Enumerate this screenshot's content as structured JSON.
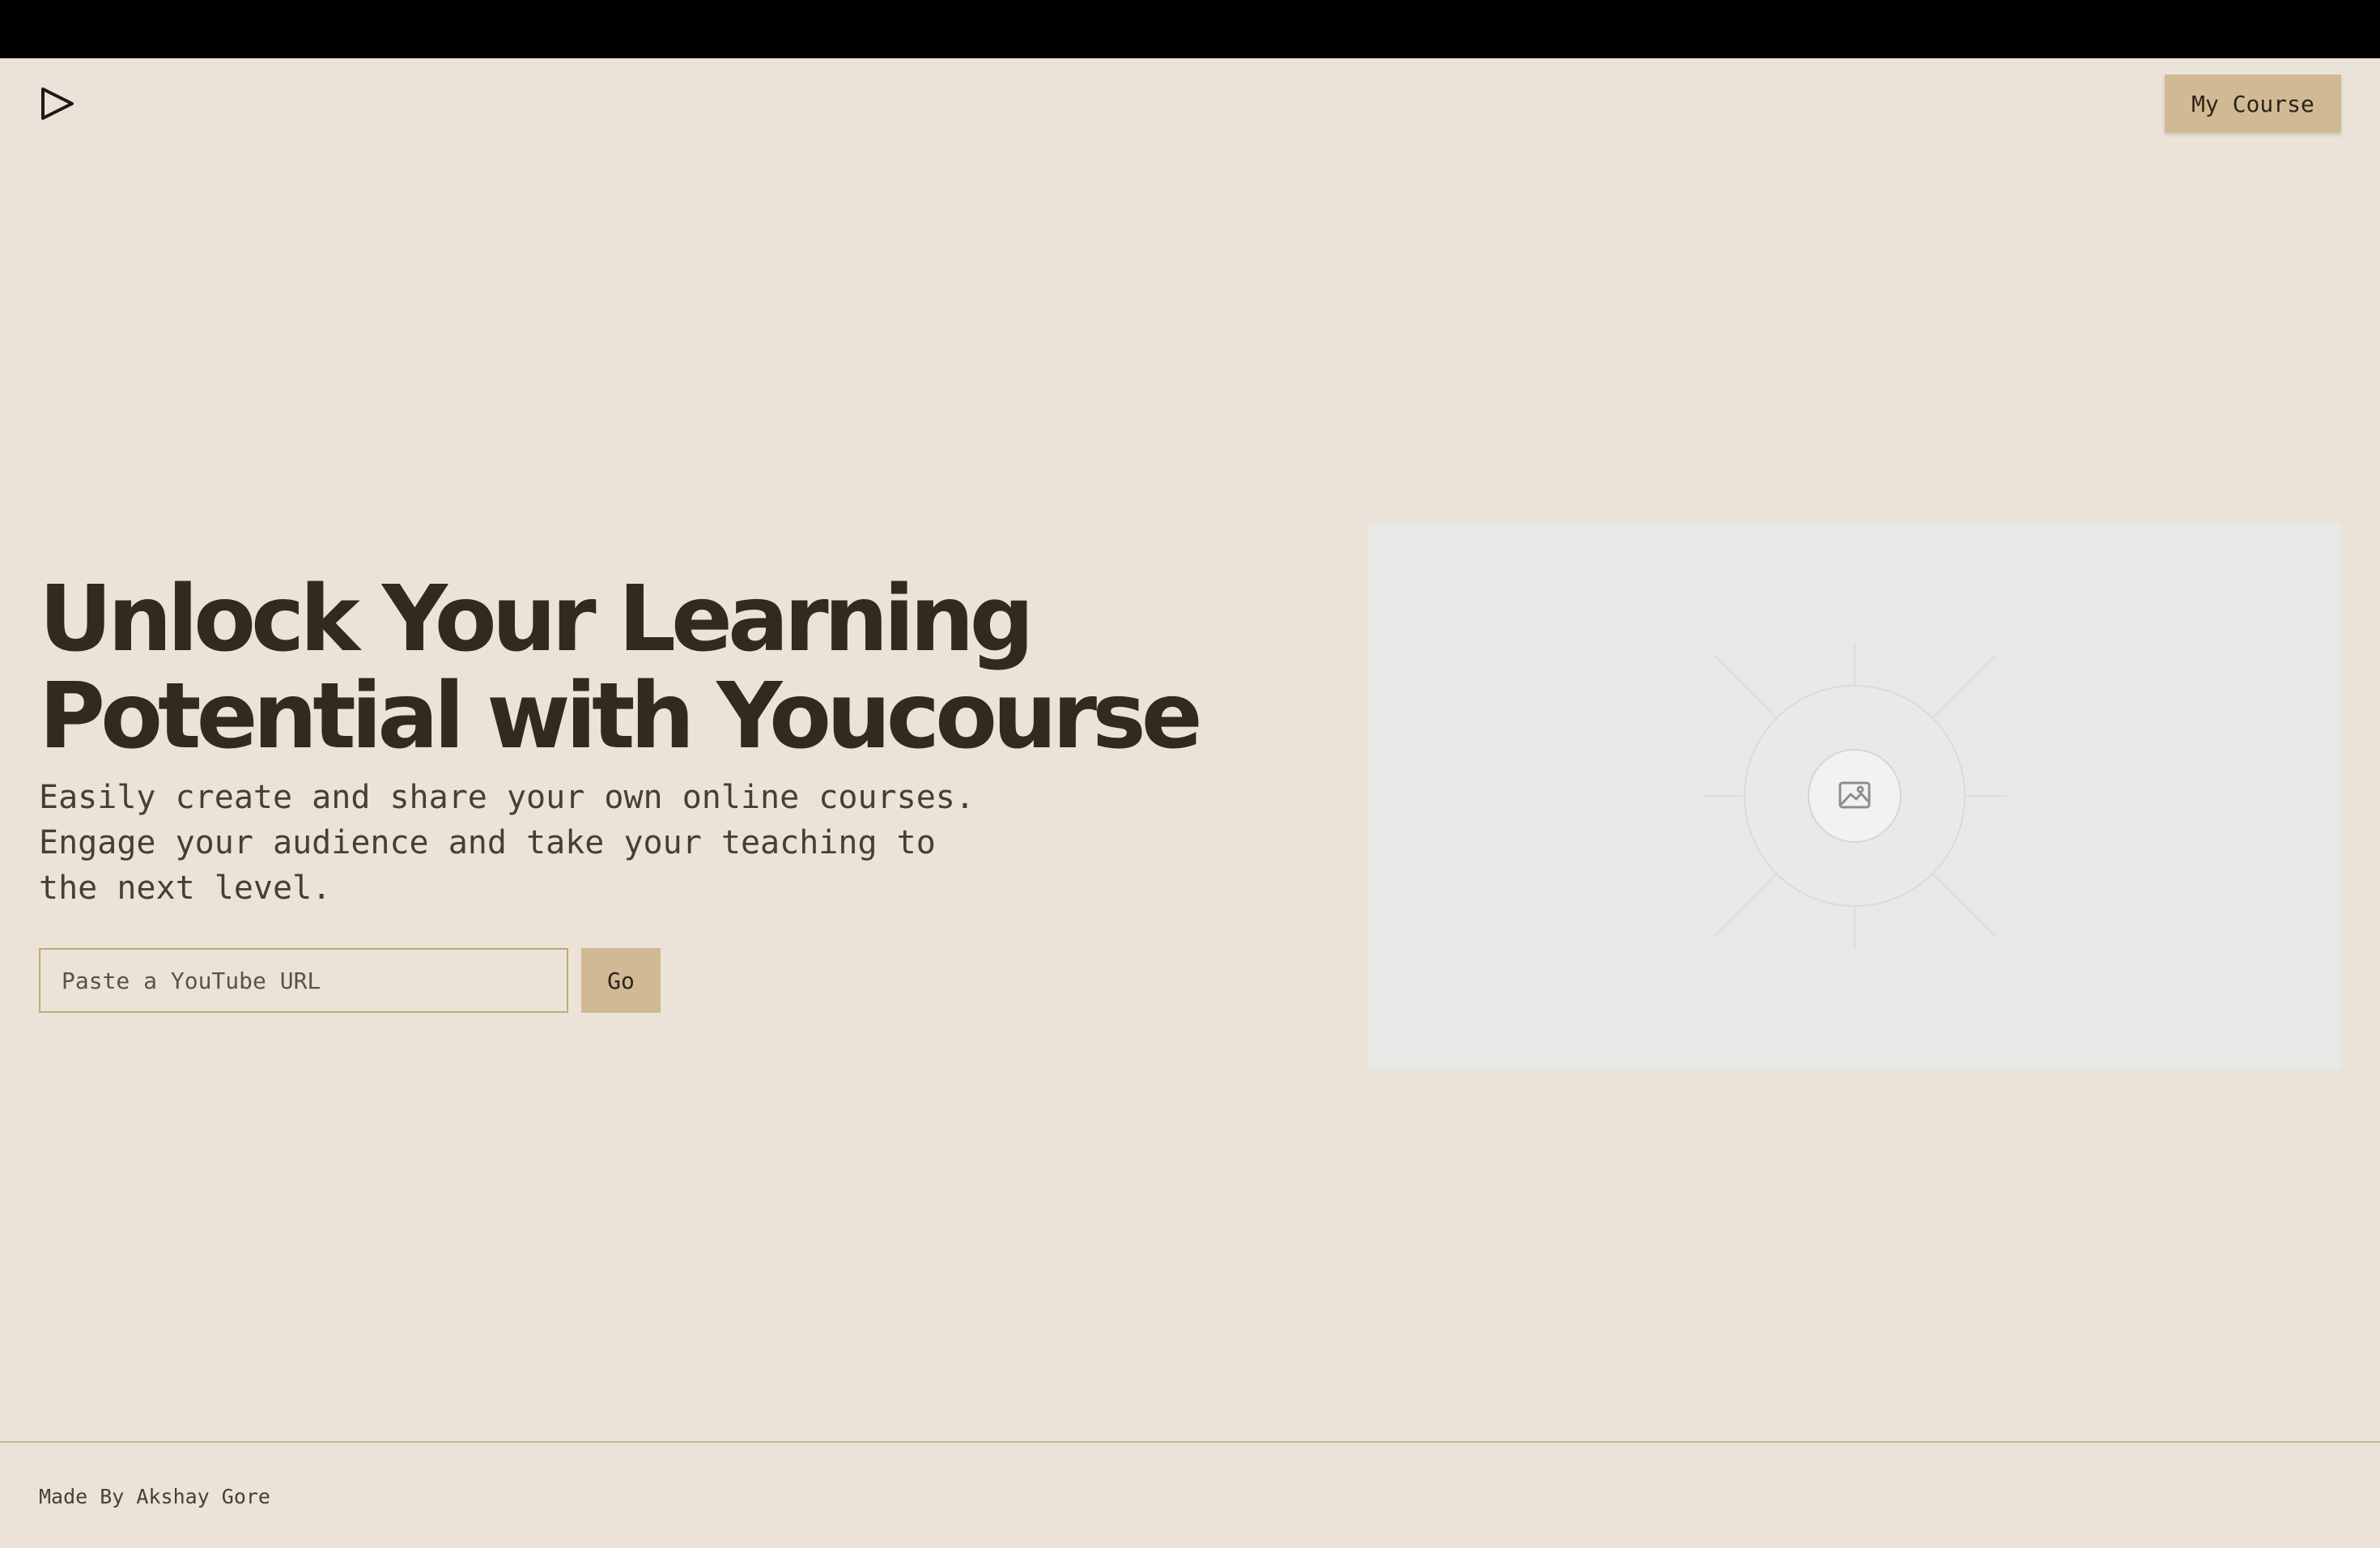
{
  "header": {
    "logo_icon": "play-triangle-icon",
    "my_course_label": "My Course"
  },
  "hero": {
    "title_lines": [
      "Unlock Your Learning",
      "Potential with Youcourse"
    ],
    "subtitle_lines": [
      "Easily create and share your own online courses.",
      "Engage your audience and take your teaching to",
      "the next level."
    ],
    "url_input": {
      "placeholder": "Paste a YouTube URL",
      "value": ""
    },
    "go_label": "Go",
    "image_placeholder_icon": "image-icon"
  },
  "footer": {
    "credit": "Made By Akshay Gore"
  },
  "colors": {
    "background": "#ebe3d7",
    "accent": "#d2b995",
    "text_dark": "#33291c",
    "input_border": "#c1a97b",
    "placeholder_bg": "#e8e8e7"
  }
}
